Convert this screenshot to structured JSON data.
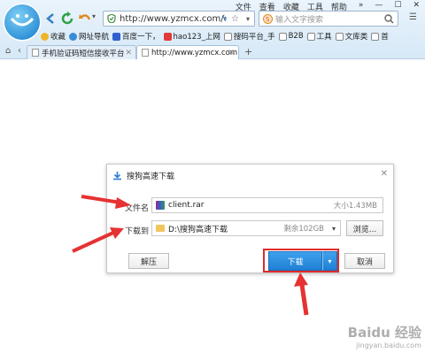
{
  "menu": [
    "文件",
    "查看",
    "收藏",
    "工具",
    "帮助"
  ],
  "window_controls": [
    "»",
    "—",
    "☐",
    "✕"
  ],
  "address": {
    "url": "http://www.yzmcx.com/c",
    "placeholder": "输入文字搜索"
  },
  "bookmarks": [
    {
      "label": "收藏",
      "color": "#f0b429"
    },
    {
      "label": "网址导航",
      "color": "#3a8bd8"
    },
    {
      "label": "百度一下，",
      "color": "#2f5fd0"
    },
    {
      "label": "hao123_上网",
      "color": "#e23a3a"
    },
    {
      "label": "搜码平台_手",
      "color": "#888888"
    },
    {
      "label": "B2B",
      "color": "#888888"
    },
    {
      "label": "工具",
      "color": "#888888"
    },
    {
      "label": "文库类",
      "color": "#888888"
    },
    {
      "label": "首",
      "color": "#888888"
    }
  ],
  "tabs": [
    {
      "label": "手机验证码短信接收平台"
    },
    {
      "label": "http://www.yzmcx.com"
    }
  ],
  "dialog": {
    "title": "搜狗高速下载",
    "filename_label": "文件名",
    "filename": "client.rar",
    "filesize": "大小1.43MB",
    "saveto_label": "下载到",
    "path": "D:\\搜狗高速下载",
    "remaining": "剩余102GB",
    "browse": "浏览...",
    "unzip": "解压",
    "download": "下载",
    "cancel": "取消"
  },
  "watermark": {
    "text": "Baidu 经验",
    "sub": "jingyan.baidu.com"
  },
  "colors": {
    "accent": "#1f7fd4",
    "highlight": "#e02a2a"
  }
}
